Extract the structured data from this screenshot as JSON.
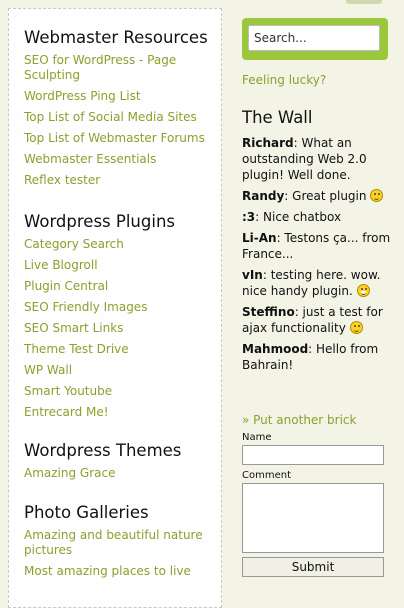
{
  "left_column": {
    "webmaster_resources": {
      "title": "Webmaster Resources",
      "links": [
        "SEO for WordPress - Page Sculpting",
        "WordPress Ping List",
        "Top List of Social Media Sites",
        "Top List of Webmaster Forums",
        "Webmaster Essentials",
        "Reflex tester"
      ]
    },
    "wordpress_plugins": {
      "title": "Wordpress Plugins",
      "links": [
        "Category Search",
        "Live Blogroll",
        "Plugin Central",
        "SEO Friendly Images",
        "SEO Smart Links",
        "Theme Test Drive",
        "WP Wall",
        "Smart Youtube",
        "Entrecard Me!"
      ]
    },
    "wordpress_themes": {
      "title": "Wordpress Themes",
      "links": [
        "Amazing Grace"
      ]
    },
    "photo_galleries": {
      "title": "Photo Galleries",
      "links": [
        "Amazing and beautiful nature pictures",
        "Most amazing places to live"
      ]
    }
  },
  "right_column": {
    "search": {
      "placeholder": "Search..."
    },
    "feeling_lucky": "Feeling lucky?",
    "wall": {
      "title": "The Wall",
      "entries": [
        {
          "author": "Richard",
          "text": ": What an outstanding Web 2.0 plugin! Well done."
        },
        {
          "author": "Randy",
          "text": ": Great plugin"
        },
        {
          "author": ":3",
          "text": ": Nice chatbox"
        },
        {
          "author": "Li-An",
          "text": ": Testons ça... from France..."
        },
        {
          "author": "vIn",
          "text": ": testing here. wow. nice handy plugin."
        },
        {
          "author": "Steffino",
          "text": ": just a test for ajax functionality"
        },
        {
          "author": "Mahmood",
          "text": ": Hello from Bahrain!"
        }
      ],
      "put_brick": "» Put another brick",
      "form": {
        "name_label": "Name",
        "comment_label": "Comment",
        "submit_label": "Submit"
      }
    }
  },
  "colors": {
    "link": "#8aa12d",
    "search_bg": "#9bc83a",
    "page_bg": "#f3f3e6"
  },
  "icons": [
    "smiley-icon"
  ]
}
